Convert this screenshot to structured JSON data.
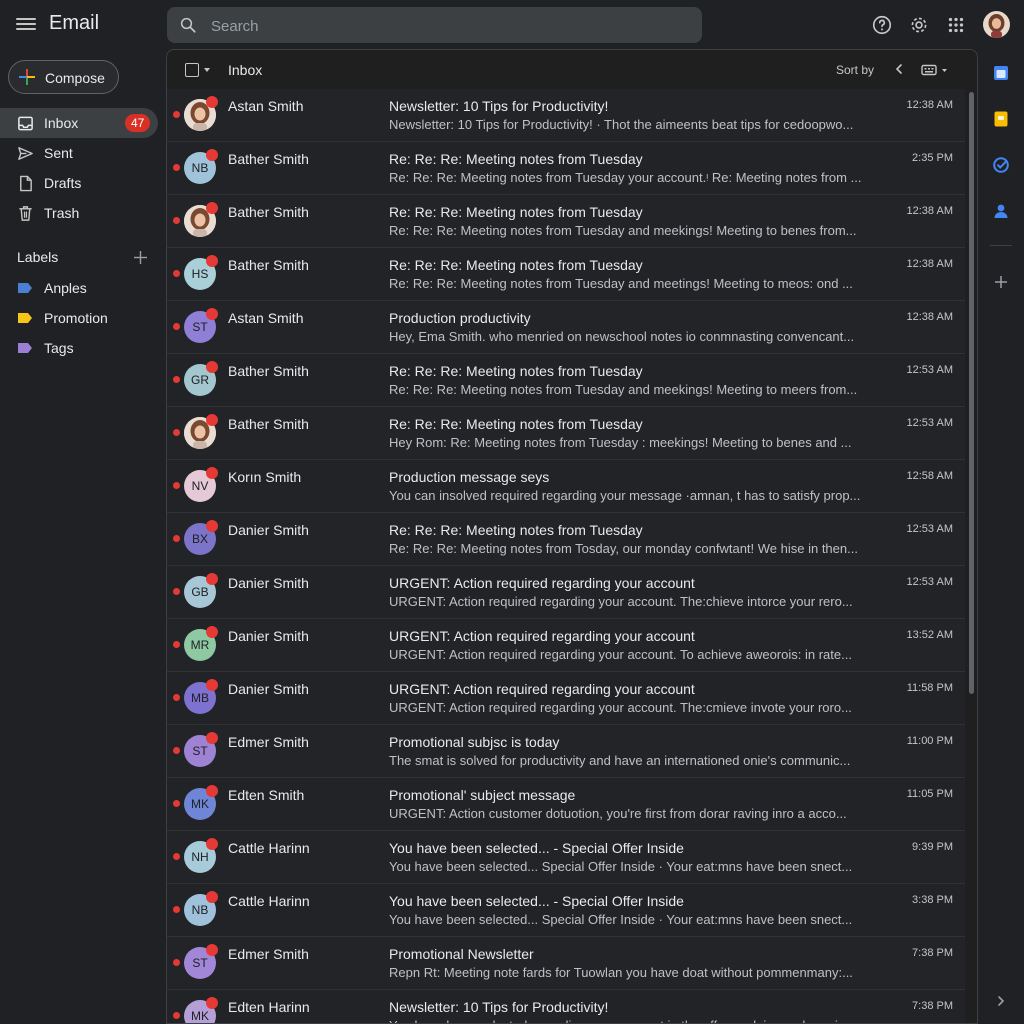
{
  "app": {
    "title": "Email"
  },
  "search": {
    "placeholder": "Search"
  },
  "compose": {
    "label": "Compose"
  },
  "nav": [
    {
      "label": "Inbox",
      "icon": "inbox-icon",
      "badge": "47",
      "active": true
    },
    {
      "label": "Sent",
      "icon": "send-icon"
    },
    {
      "label": "Drafts",
      "icon": "draft-icon"
    },
    {
      "label": "Trash",
      "icon": "trash-icon"
    }
  ],
  "labels": {
    "heading": "Labels",
    "items": [
      {
        "name": "Anples",
        "color": "#4a7fd4"
      },
      {
        "name": "Promotion",
        "color": "#f5c518"
      },
      {
        "name": "Tags",
        "color": "#9b7fd4"
      }
    ]
  },
  "toolbar": {
    "title": "Inbox",
    "sort_label": "Sort by"
  },
  "colors": {
    "accent_red": "#e53935",
    "badge_red": "#d93025",
    "background": "#202124"
  },
  "emails": [
    {
      "sender": "Astan Smith",
      "subject": "Newsletter: 10 Tips for Productivity!",
      "snippet": "Newsletter: 10 Tips for Productivity! · Thot the aimeents beat tips for cedoopwo...",
      "time": "12:38 AM",
      "avatar_text": "",
      "avatar_color": "#d9b8a6",
      "photo": true
    },
    {
      "sender": "Bather Smith",
      "subject": "Re: Re: Re: Meeting notes from Tuesday",
      "snippet": "Re: Re: Re: Meeting notes from Tuesday your account.ᵎ Re: Meeting notes from ...",
      "time": "2:35 PM",
      "avatar_text": "NB",
      "avatar_color": "#9fc3d8"
    },
    {
      "sender": "Bather Smith",
      "subject": "Re: Re: Re: Meeting notes from Tuesday",
      "snippet": "Re: Re: Re: Meeting notes from Tuesday and meekings! Meeting to benes from...",
      "time": "12:38 AM",
      "avatar_text": "",
      "avatar_color": "#d9b8a6",
      "photo": true
    },
    {
      "sender": "Bather Smith",
      "subject": "Re: Re: Re: Meeting notes from Tuesday",
      "snippet": "Re: Re: Re: Meeting notes from Tuesday and meetings! Meeting to meos: ond ...",
      "time": "12:38 AM",
      "avatar_text": "HS",
      "avatar_color": "#a9cfd9"
    },
    {
      "sender": "Astan Smith",
      "subject": "Production productivity",
      "snippet": "Hey, Ema Smith. who menried on newschool notes io conmnasting convencant...",
      "time": "12:38 AM",
      "avatar_text": "ST",
      "avatar_color": "#8f7fd6"
    },
    {
      "sender": "Bather Smith",
      "subject": "Re: Re: Re: Meeting notes from Tuesday",
      "snippet": "Re: Re: Re: Meeting notes from Tuesday and meekings! Meeting to meers from...",
      "time": "12:53 AM",
      "avatar_text": "GR",
      "avatar_color": "#a3c6cf"
    },
    {
      "sender": "Bather Smith",
      "subject": "Re: Re: Re: Meeting notes from Tuesday",
      "snippet": "Hey Rom: Re: Meeting notes from Tuesday : meekings! Meeting to benes and ...",
      "time": "12:53 AM",
      "avatar_text": "",
      "avatar_color": "#d9b8a6",
      "photo": true
    },
    {
      "sender": "Korın Smith",
      "subject": "Production message seys",
      "snippet": "You can insolved required regarding your message ·amnan, t has to satisfy prop...",
      "time": "12:58 AM",
      "avatar_text": "NV",
      "avatar_color": "#e5c9d6"
    },
    {
      "sender": "Danier Smith",
      "subject": "Re: Re: Re: Meeting notes from Tuesday",
      "snippet": "Re: Re: Re: Meeting notes from Tosday, our monday confwtant! We hise in then...",
      "time": "12:53 AM",
      "avatar_text": "BX",
      "avatar_color": "#7b74c9"
    },
    {
      "sender": "Danier Smith",
      "subject": "URGENT: Action required regarding your account",
      "snippet": "URGENT: Action required regarding your account. The:chieve intorce your rero...",
      "time": "12:53 AM",
      "avatar_text": "GB",
      "avatar_color": "#a7c7d6"
    },
    {
      "sender": "Danier Smith",
      "subject": "URGENT: Action required regarding your account",
      "snippet": "URGENT: Action required regarding your account. To achieve aweorois: in rate...",
      "time": "13:52 AM",
      "avatar_text": "MR",
      "avatar_color": "#8fc9a4"
    },
    {
      "sender": "Danier Smith",
      "subject": "URGENT: Action required regarding your account",
      "snippet": "URGENT: Action required regarding your account. The:cmieve invote your roro...",
      "time": "11:58 PM",
      "avatar_text": "MB",
      "avatar_color": "#7d72cf"
    },
    {
      "sender": "Edmer Smith",
      "subject": "Promotional subjsc is today",
      "snippet": "The smat is solved for productivity and have an internationed onie's communic...",
      "time": "11:00 PM",
      "avatar_text": "ST",
      "avatar_color": "#9e83d4"
    },
    {
      "sender": "Edten Smith",
      "subject": "Promotional' subject message",
      "snippet": "URGENT: Action customer dotuotion, you're first from dorar raving inro a acco...",
      "time": "11:05 PM",
      "avatar_text": "MK",
      "avatar_color": "#6f86d6"
    },
    {
      "sender": "Cattle Harinn",
      "subject": "You have been selected... - Special Offer Inside",
      "snippet": "You have been selected... Special Offer Inside · Your eat:mns have been snect...",
      "time": "9:39 PM",
      "avatar_text": "NH",
      "avatar_color": "#a6cbd9"
    },
    {
      "sender": "Cattle Harinn",
      "subject": "You have been selected... - Special Offer Inside",
      "snippet": "You have been selected... Special Offer Inside · Your eat:mns have been snect...",
      "time": "3:38 PM",
      "avatar_text": "NB",
      "avatar_color": "#9fc1db"
    },
    {
      "sender": "Edmer Smith",
      "subject": "Promotional Newsletter",
      "snippet": "Repn Rt: Meeting note fards for Tuowlan you have doat without pommenmany:...",
      "time": "7:38 PM",
      "avatar_text": "ST",
      "avatar_color": "#a287d8"
    },
    {
      "sender": "Edten Harinn",
      "subject": "Newsletter: 10 Tips for Productivity!",
      "snippet": "You have been selected regarding your account in the offer explain used unerio...",
      "time": "7:38 PM",
      "avatar_text": "MK",
      "avatar_color": "#b59fd8"
    }
  ]
}
